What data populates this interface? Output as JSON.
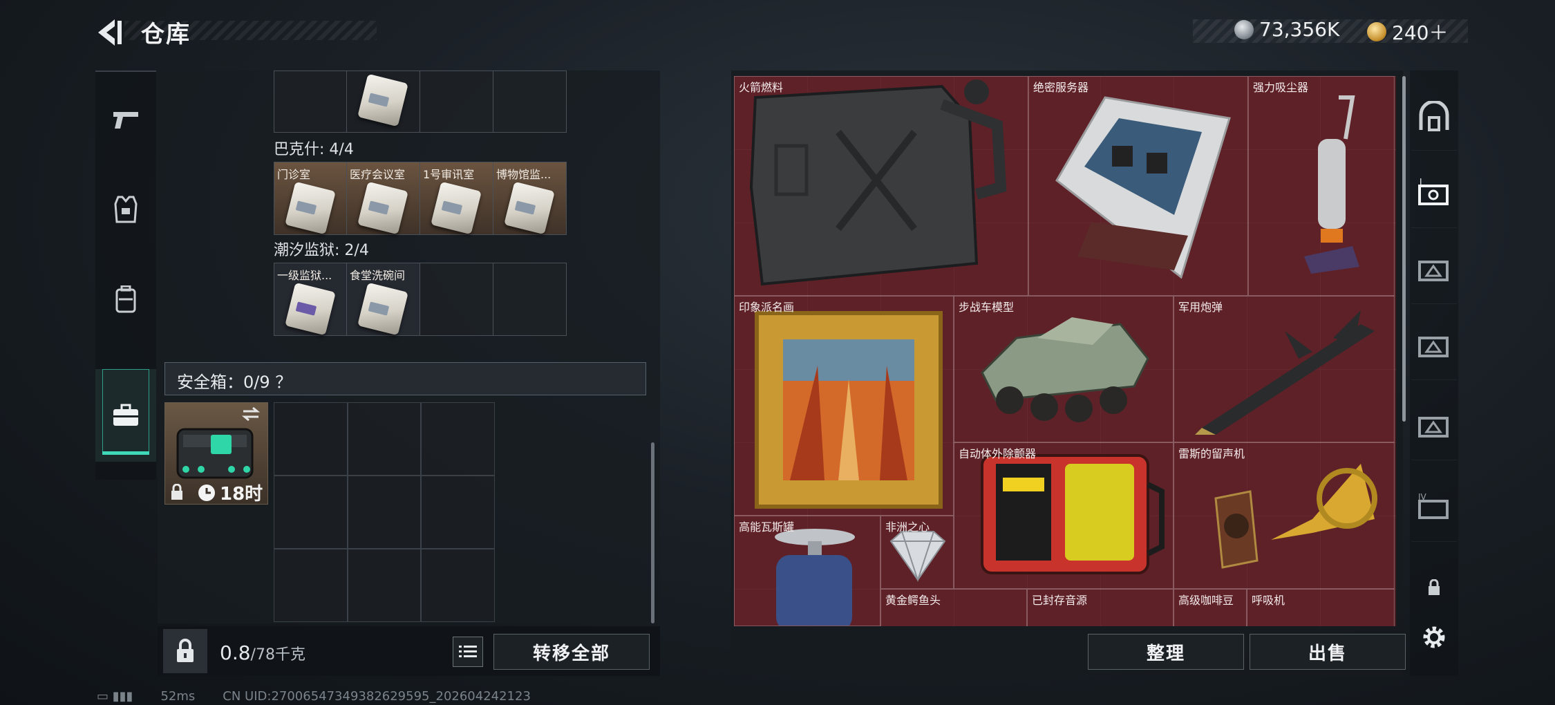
{
  "header": {
    "title": "仓库",
    "silver_amount": "73,356K",
    "gold_amount": "240＋"
  },
  "backpack": {
    "keycard_groups": [
      {
        "title": "巴克什: 4/4",
        "cards": [
          "门诊室",
          "医疗会议室",
          "1号审讯室",
          "博物馆监..."
        ]
      },
      {
        "title": "潮汐监狱: 2/4",
        "cards": [
          "一级监狱...",
          "食堂洗碗间",
          "",
          ""
        ]
      }
    ],
    "safe_box": {
      "title": "安全箱：0/9 ？",
      "timer": "18时"
    },
    "weight": {
      "value": "0.8",
      "capacity": "/78千克"
    },
    "transfer_all_label": "转移全部"
  },
  "stash": {
    "items": [
      {
        "name": "火箭燃料"
      },
      {
        "name": "绝密服务器"
      },
      {
        "name": "强力吸尘器"
      },
      {
        "name": "印象派名画"
      },
      {
        "name": "步战车模型"
      },
      {
        "name": "军用炮弹"
      },
      {
        "name": "自动体外除颤器"
      },
      {
        "name": "雷斯的留声机"
      },
      {
        "name": "高能瓦斯罐"
      },
      {
        "name": "非洲之心"
      },
      {
        "name": "黄金鳄鱼头"
      },
      {
        "name": "已封存音源"
      },
      {
        "name": "高级咖啡豆"
      },
      {
        "name": "呼吸机"
      }
    ],
    "sort_label": "整理",
    "sell_label": "出售"
  },
  "status": {
    "ping": "52ms",
    "uid": "CN UID:270065473493826295​95_202604242123"
  },
  "colors": {
    "accent": "#3fd8b8",
    "stash_bg": "#4a1f24",
    "item_bg": "#70222c"
  }
}
